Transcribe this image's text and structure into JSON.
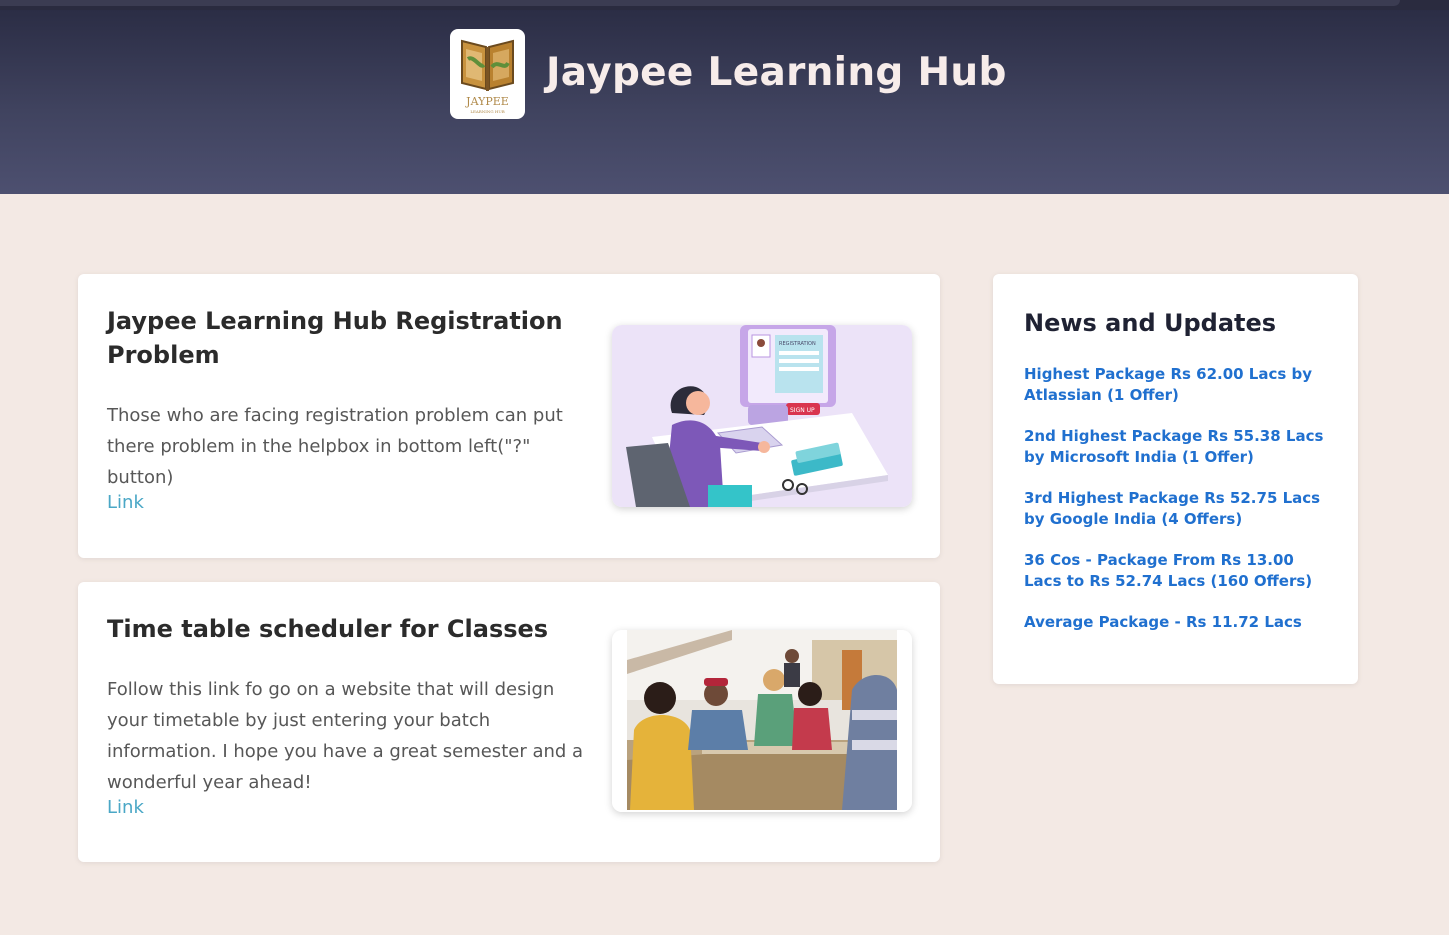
{
  "header": {
    "title": "Jaypee Learning Hub",
    "logo_text": "JAYPEE",
    "logo_subtext": "LEARNING HUB"
  },
  "cards": [
    {
      "title": "Jaypee Learning Hub Registration Problem",
      "description": "Those who are facing registration problem can put there problem in the helpbox in bottom left(\"?\" button)",
      "link_label": "Link",
      "image_text": "REGISTRATION",
      "image_button": "SIGN UP"
    },
    {
      "title": "Time table scheduler for Classes",
      "description": "Follow this link fo go on a website that will design your timetable by just entering your batch information. I hope you have a great semester and a wonderful year ahead!",
      "link_label": "Link"
    }
  ],
  "news": {
    "title": "News and Updates",
    "items": [
      "Highest Package Rs 62.00 Lacs by Atlassian (1 Offer)",
      "2nd Highest Package Rs 55.38 Lacs by Microsoft India (1 Offer)",
      "3rd Highest Package Rs 52.75 Lacs by Google India (4 Offers)",
      "36 Cos - Package From Rs 13.00 Lacs to Rs 52.74 Lacs (160 Offers)",
      "Average Package - Rs 11.72 Lacs"
    ]
  },
  "colors": {
    "header_bg": "#40435f",
    "page_bg": "#f3e9e4",
    "link": "#4aa7c6",
    "news_link": "#2070cf"
  }
}
